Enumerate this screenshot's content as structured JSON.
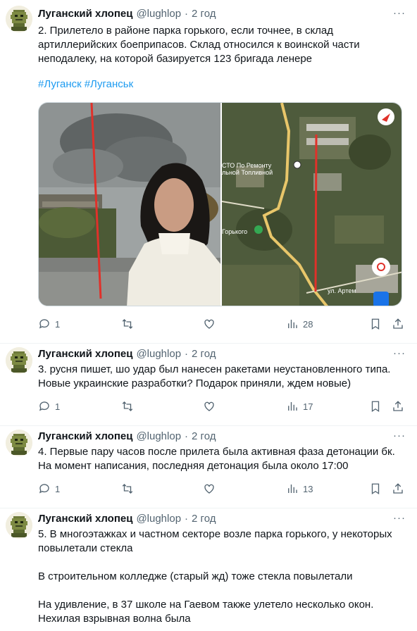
{
  "tweets": [
    {
      "author": "Луганский хлопец",
      "handle": "@lughlop",
      "dot": "·",
      "time": "2 год",
      "text": [
        "2. Прилетело в районе парка горького, если точнее, в склад",
        "артиллерийских боеприпасов. Склад относился к воинской части",
        "неподалеку, на которой базируется 123 бригада ленере"
      ],
      "hashtags": [
        "#Луганск",
        "#Луганськ"
      ],
      "replies": "1",
      "retweets": "",
      "likes": "",
      "views": "28",
      "map_labels": [
        "СТО По Ремонту",
        "льной Топливной",
        "Горького",
        "ул. Артем"
      ]
    },
    {
      "author": "Луганский хлопец",
      "handle": "@lughlop",
      "dot": "·",
      "time": "2 год",
      "text": [
        "3. русня пишет, шо удар был нанесен ракетами неустановленного типа.",
        "Новые украинские разработки? Подарок приняли, ждем новые)"
      ],
      "replies": "1",
      "retweets": "",
      "likes": "",
      "views": "17"
    },
    {
      "author": "Луганский хлопец",
      "handle": "@lughlop",
      "dot": "·",
      "time": "2 год",
      "text": [
        "4. Первые пару часов после прилета была активная фаза детонации бк.",
        "На момент написания, последняя детонация была около 17:00"
      ],
      "replies": "1",
      "retweets": "",
      "likes": "",
      "views": "13"
    },
    {
      "author": "Луганский хлопец",
      "handle": "@lughlop",
      "dot": "·",
      "time": "2 год",
      "text": [
        "5. В многоэтажках и частном секторе возле парка горького, у некоторых",
        "повылетали стекла",
        "",
        "В строительном колледже (старый жд) тоже стекла повылетали",
        "",
        "На удивление, в 37 школе на Гаевом также улетело несколько окон.",
        "Нехилая взрывная волна была"
      ]
    }
  ],
  "more_icon": "···",
  "colors": {
    "text": "#0f1419",
    "secondary": "#536471",
    "link": "#1d9bf0",
    "divider": "#eff3f4"
  }
}
